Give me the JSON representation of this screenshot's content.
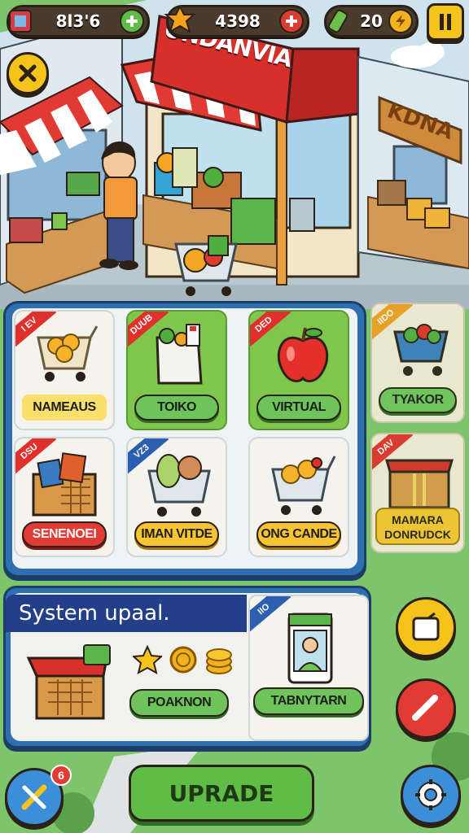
{
  "topbar": {
    "cash_value": "8l3'6",
    "gems_value": "4398",
    "energy_value": "20"
  },
  "shop": {
    "sign_main": "UNDANVIA",
    "sign_side": "KDNA"
  },
  "grid": {
    "cards": [
      {
        "tag": "I EV",
        "label": "NAMEAUS"
      },
      {
        "tag": "DUUB",
        "label": "TOIKO"
      },
      {
        "tag": "DED",
        "label": "VIRTUAL"
      },
      {
        "tag": "DSU",
        "label": "SENENOEI"
      },
      {
        "tag": "VZ3",
        "label": "IMAN VITDE"
      },
      {
        "tag": "",
        "label": "ONG CANDE"
      }
    ],
    "side_cards": [
      {
        "tag": "IIDO",
        "label": "TYAKOR"
      },
      {
        "tag": "DAV",
        "label_line1": "MAMARA",
        "label_line2": "DONRUDCK"
      }
    ]
  },
  "update_panel": {
    "title": "System upaal.",
    "reward_button": "POAKNON",
    "card_tag": "IIO",
    "card_button": "TABNYTARN"
  },
  "bottom": {
    "badge_count": "6",
    "upgrade_label": "UPRADE"
  },
  "colors": {
    "accent_blue": "#2e6fb0",
    "button_green": "#6ec45a",
    "button_yellow": "#f6c531",
    "button_red": "#e23a35"
  },
  "icons": [
    "cash-icon",
    "gem-icon",
    "energy-icon",
    "pause-icon",
    "close-icon",
    "shopping-cart-icon",
    "apple-icon",
    "crate-icon",
    "star-icon",
    "coin-icon",
    "clipboard-icon",
    "pencil-icon",
    "settings-icon",
    "tools-icon"
  ]
}
